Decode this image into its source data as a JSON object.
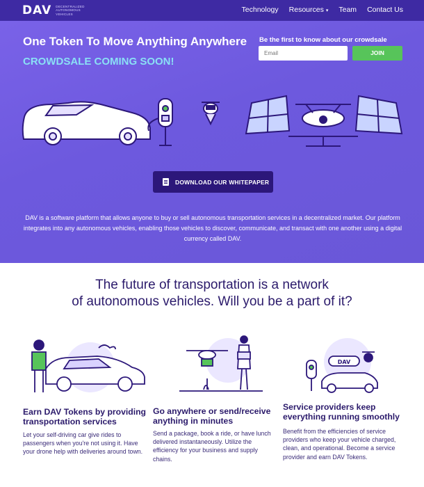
{
  "nav": {
    "logo_mark": "DAV",
    "logo_sub": [
      "DECENTRALIZED",
      "AUTONOMOUS",
      "VEHICLES"
    ],
    "links": [
      "Technology",
      "Resources",
      "Team",
      "Contact Us"
    ]
  },
  "hero": {
    "title": "One Token To Move Anything Anywhere",
    "subtitle": "CROWDSALE COMING SOON!",
    "signup_label": "Be the first to know about our crowdsale",
    "email_placeholder": "Email",
    "join_label": "JOIN",
    "whitepaper_label": "DOWNLOAD OUR WHITEPAPER",
    "description": "DAV is a software platform that allows anyone to buy or sell autonomous transportation services in a decentralized market. Our platform integrates into any autonomous vehicles, enabling those vehicles to discover, communicate, and transact with one another using a digital currency called DAV."
  },
  "section": {
    "tagline_line1": "The future of transportation is a network",
    "tagline_line2": "of autonomous vehicles. Will you be a part of it?",
    "columns": [
      {
        "title": "Earn DAV Tokens by providing transportation services",
        "text": "Let your self-driving car give rides to passengers when you're not using it. Have your drone help with deliveries around town."
      },
      {
        "title": "Go anywhere or send/receive anything in minutes",
        "text": "Send a package, book a ride, or have lunch delivered instantaneously. Utilize the efficiency for your business and supply chains."
      },
      {
        "title": "Service providers keep everything running smoothly",
        "text": "Benefit from the efficiencies of service providers who keep your vehicle charged, clean, and operational. Become a service provider and earn DAV Tokens."
      }
    ],
    "badge_text": "DAV"
  },
  "colors": {
    "nav_bg": "#3e2aa3",
    "accent_green": "#57c45a",
    "subtitle_cyan": "#8ae0f5",
    "dark_purple": "#2c177a"
  }
}
